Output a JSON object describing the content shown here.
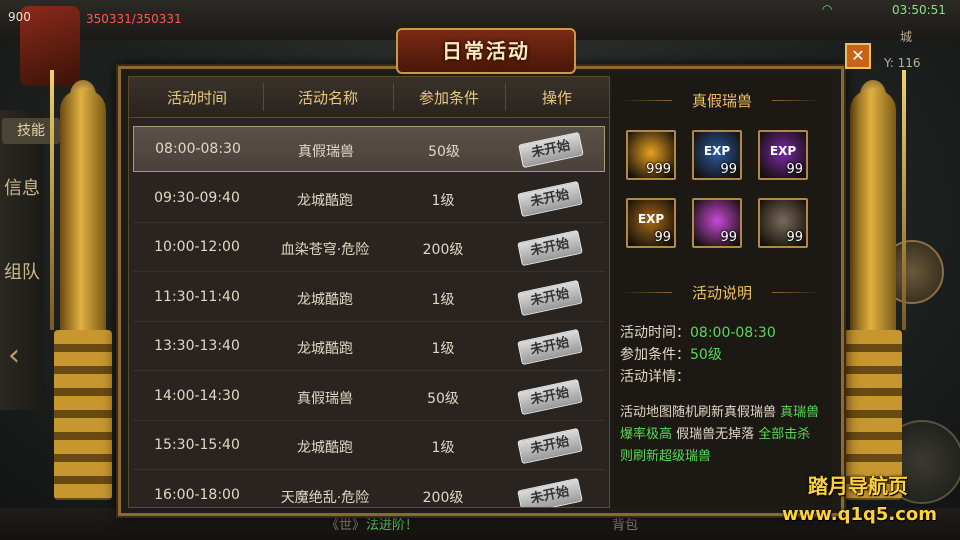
{
  "hud": {
    "level": "900",
    "hp": "350331/350331",
    "clock": "03:50:51",
    "map_name": "城",
    "coord_y": "Y: 116",
    "skill_tab": "技能",
    "side_tabs": [
      {
        "label": "信息"
      },
      {
        "label": "组队"
      }
    ],
    "chat_channel": "《世》",
    "chat_message": "法进阶！",
    "bag_label": "背包"
  },
  "dialog": {
    "title": "日常活动",
    "close_glyph": "✕",
    "columns": [
      "活动时间",
      "活动名称",
      "参加条件",
      "操作"
    ],
    "rows": [
      {
        "time": "08:00-08:30",
        "name": "真假瑞兽",
        "cond": "50级",
        "status": "未开始",
        "selected": true
      },
      {
        "time": "09:30-09:40",
        "name": "龙城酷跑",
        "cond": "1级",
        "status": "未开始"
      },
      {
        "time": "10:00-12:00",
        "name": "血染苍穹·危险",
        "cond": "200级",
        "status": "未开始"
      },
      {
        "time": "11:30-11:40",
        "name": "龙城酷跑",
        "cond": "1级",
        "status": "未开始"
      },
      {
        "time": "13:30-13:40",
        "name": "龙城酷跑",
        "cond": "1级",
        "status": "未开始"
      },
      {
        "time": "14:00-14:30",
        "name": "真假瑞兽",
        "cond": "50级",
        "status": "未开始"
      },
      {
        "time": "15:30-15:40",
        "name": "龙城酷跑",
        "cond": "1级",
        "status": "未开始"
      },
      {
        "time": "16:00-18:00",
        "name": "天魔绝乱·危险",
        "cond": "200级",
        "status": "未开始"
      }
    ],
    "detail": {
      "reward_title": "真假瑞兽",
      "rewards": [
        {
          "icon": "gold-ingot-icon",
          "label": "",
          "qty": "999",
          "color": "#e8a020"
        },
        {
          "icon": "exp-blue-icon",
          "label": "EXP",
          "qty": "99",
          "color": "#2a5aa0"
        },
        {
          "icon": "exp-purple-icon",
          "label": "EXP",
          "qty": "99",
          "color": "#7a2aa8"
        },
        {
          "icon": "exp-gold-icon",
          "label": "EXP",
          "qty": "99",
          "color": "#a86a18"
        },
        {
          "icon": "rainbow-gem-icon",
          "label": "",
          "qty": "99",
          "color": "#c84ad8"
        },
        {
          "icon": "ore-icon",
          "label": "",
          "qty": "99",
          "color": "#7a6a5a"
        }
      ],
      "desc_title": "活动说明",
      "time_label": "活动时间：",
      "time_value": "08:00-08:30",
      "cond_label": "参加条件：",
      "cond_value": "50级",
      "details_label": "活动详情：",
      "desc_white1": "活动地图随机刷新真假瑞兽 ",
      "desc_green1": "真瑞兽爆率极高",
      "desc_white2": " 假瑞兽无掉落 ",
      "desc_green2": "全部击杀则刷新超级瑞兽"
    }
  },
  "watermark": {
    "line1": "踏月导航页",
    "line2": "www.q1q5.com"
  }
}
